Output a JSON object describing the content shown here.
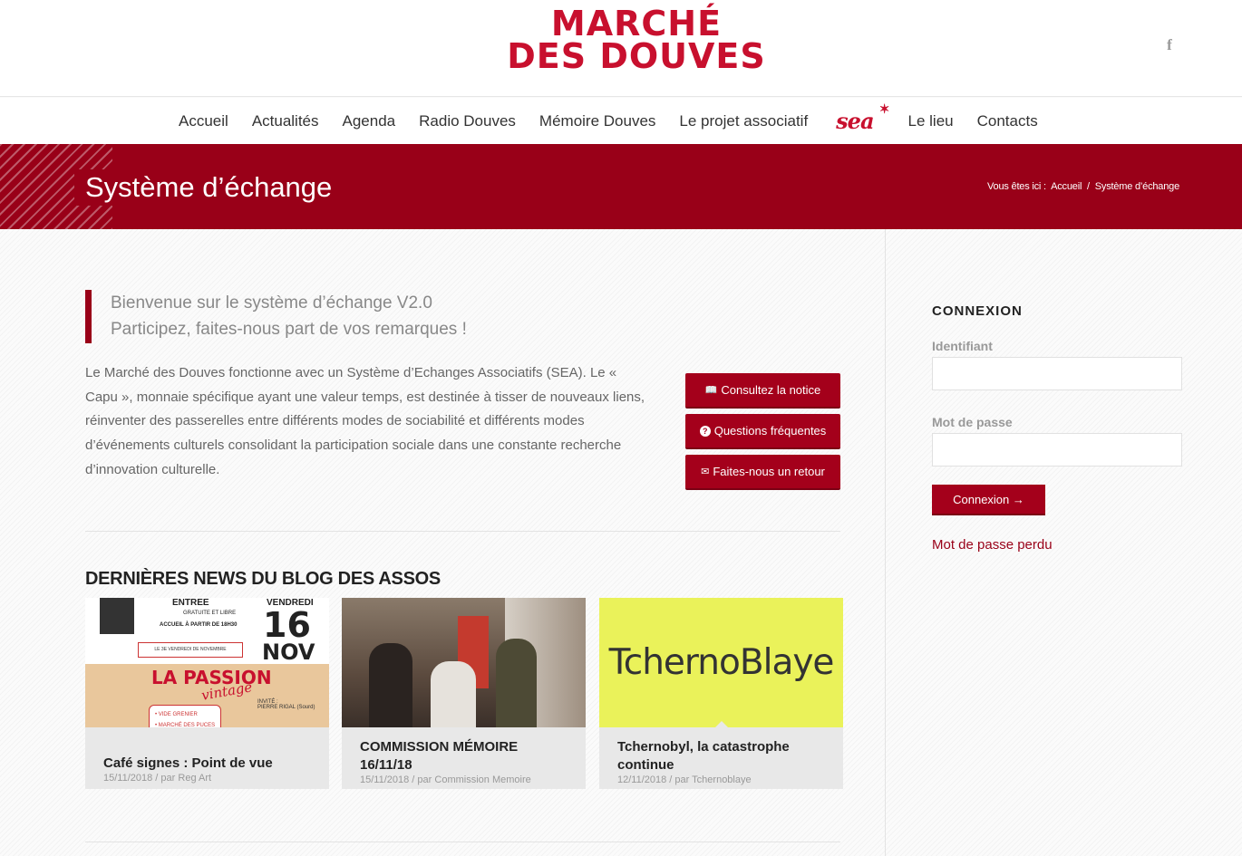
{
  "header": {
    "logo_line1": "MARCHÉ",
    "logo_line2": "DES DOUVES",
    "facebook_glyph": "f"
  },
  "nav": {
    "items": [
      "Accueil",
      "Actualités",
      "Agenda",
      "Radio Douves",
      "Mémoire Douves",
      "Le projet associatif",
      "sea",
      "Le lieu",
      "Contacts"
    ]
  },
  "title_band": {
    "title": "Système d’échange",
    "breadcrumb_prefix": "Vous êtes ici :",
    "breadcrumb_home": "Accueil",
    "breadcrumb_sep": "/",
    "breadcrumb_current": "Système d’échange"
  },
  "main": {
    "quote_line1": "Bienvenue sur le système d’échange V2.0",
    "quote_line2": "Participez, faites-nous part de vos remarques !",
    "intro": "Le Marché des Douves fonctionne avec un Système d’Echanges Associatifs (SEA).  Le « Capu », monnaie spécifique ayant une valeur temps, est destinée à tisser de nouveaux liens, réinventer des passerelles entre différents modes de sociabilité et différents modes d’événements culturels consolidant la participation sociale dans une constante recherche d’innovation culturelle.",
    "buttons": [
      {
        "icon": "📖",
        "label": "Consultez la notice"
      },
      {
        "icon": "?",
        "label": "Questions fréquentes"
      },
      {
        "icon": "✉",
        "label": "Faites-nous un retour"
      }
    ],
    "news_title": "DERNIÈRES NEWS DU BLOG DES ASSOS",
    "cards": [
      {
        "title": "Café signes : Point de vue",
        "date": "15/11/2018",
        "author": "par Reg Art"
      },
      {
        "title": "COMMISSION MÉMOIRE 16/11/18",
        "date": "15/11/2018",
        "author": "par Commission Memoire"
      },
      {
        "title": "Tchernobyl, la catastrophe continue",
        "date": "12/11/2018",
        "author": "par Tchernoblaye"
      }
    ],
    "poster": {
      "entree": "ENTREE",
      "gratuite": "GRATUITE ET LIBRE",
      "accueil": "ACCUEIL À PARTIR DE 18H30",
      "warning": "LE 3E VENDREDI DE NOVEMBRE",
      "vendredi": "VENDREDI",
      "day": "16",
      "month": "NOV",
      "passion": "LA PASSION",
      "vintage": "vintage",
      "list": "• VIDE GRENIER\n• MARCHÉ DES PUCES\n• BROCANTE",
      "invite": "INVITÉ :\nPIERRE RIGAL (Sourd)"
    },
    "tcherno_logo": "TchernoBlaye"
  },
  "sidebar": {
    "heading": "CONNEXION",
    "username_label": "Identifiant",
    "password_label": "Mot de passe",
    "login_button": "Connexion →",
    "lost_password": "Mot de passe perdu"
  },
  "colors": {
    "brand": "#c8102e",
    "band": "#990018",
    "button": "#a4001b"
  }
}
